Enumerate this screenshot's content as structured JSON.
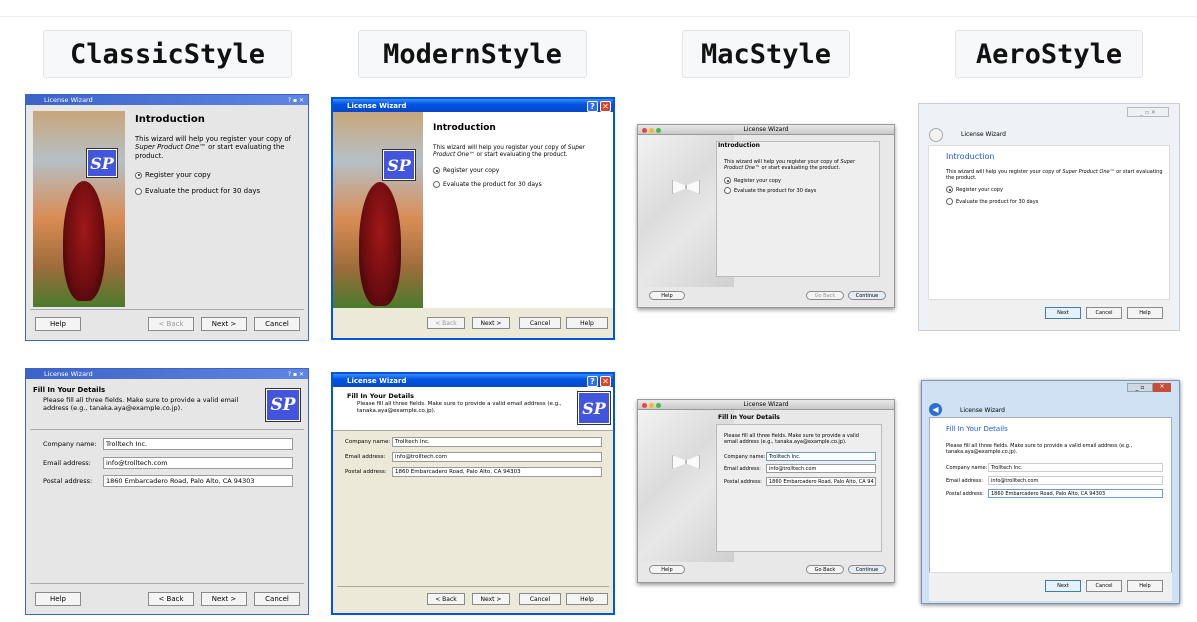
{
  "headers": [
    "ClassicStyle",
    "ModernStyle",
    "MacStyle",
    "AeroStyle"
  ],
  "window_title": "License Wizard",
  "logo_text": "SP",
  "intro": {
    "title": "Introduction",
    "text_a": "This wizard will help you register your copy of",
    "product": "Super Product One™",
    "text_b": "or start evaluating the product.",
    "opt_register": "Register your copy",
    "opt_evaluate": "Evaluate the product for 30 days"
  },
  "details": {
    "title": "Fill In Your Details",
    "desc": "Please fill all three fields. Make sure to provide a valid email address (e.g., tanaka.aya@example.co.jp).",
    "company_label": "Company name:",
    "company_value": "Trolltech Inc.",
    "email_label": "Email address:",
    "email_value": "info@trolltech.com",
    "postal_label": "Postal address:",
    "postal_value": "1860 Embarcadero Road, Palo Alto, CA 94303",
    "postal_value_mac": "1860 Embarcadero Road, Palo Alto, CA 94"
  },
  "buttons": {
    "help": "Help",
    "back": "< Back",
    "next": "Next >",
    "cancel": "Cancel",
    "go_back": "Go Back",
    "continue": "Continue",
    "next_plain": "Next"
  },
  "colors": {
    "classic_title": "#3c64c8",
    "xp_title": "#0054e3",
    "aero_heading": "#1e5ad2",
    "sp_logo": "#4455dd"
  }
}
